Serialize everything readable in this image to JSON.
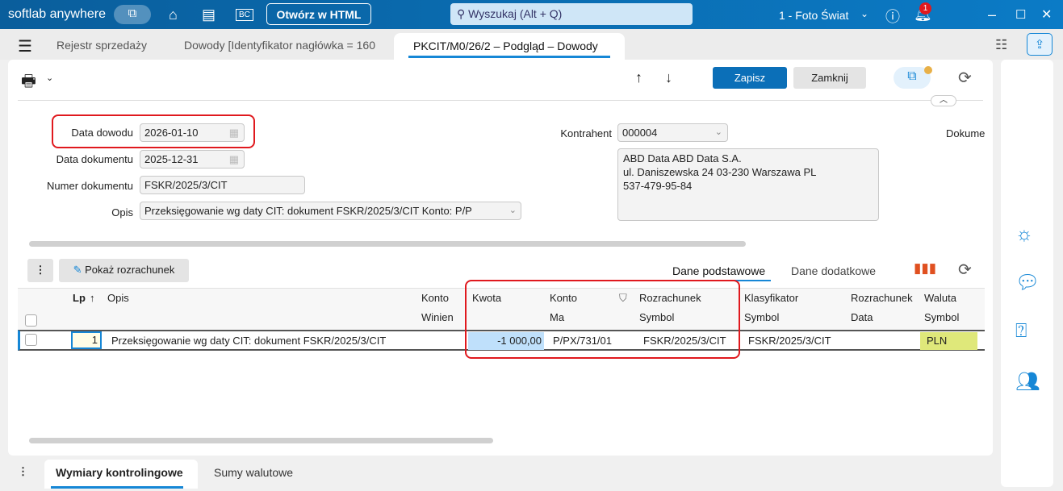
{
  "app": {
    "title": "softlab anywhere",
    "open_html": "Otwórz w HTML",
    "search_placeholder": "Wyszukaj (Alt + Q)",
    "company": "1 - Foto Świat",
    "notifications": "1"
  },
  "tabs": [
    {
      "label": "Rejestr sprzedaży"
    },
    {
      "label": "Dowody [Identyfikator nagłówka = 160"
    },
    {
      "label": "PKCIT/M0/26/2 – Podgląd – Dowody"
    }
  ],
  "toolbar": {
    "save": "Zapisz",
    "close": "Zamknij"
  },
  "form": {
    "data_dowodu_label": "Data dowodu",
    "data_dowodu": "2026-01-10",
    "data_dokumentu_label": "Data dokumentu",
    "data_dokumentu": "2025-12-31",
    "numer_label": "Numer dokumentu",
    "numer": "FSKR/2025/3/CIT",
    "opis_label": "Opis",
    "opis": "Przeksięgowanie wg daty CIT: dokument FSKR/2025/3/CIT Konto: P/P",
    "kontrahent_label": "Kontrahent",
    "kontrahent": "000004",
    "address": [
      "ABD Data ABD Data S.A.",
      "ul. Daniszewska 24 03-230 Warszawa PL",
      "537-479-95-84"
    ],
    "dokument_label": "Dokume"
  },
  "grid": {
    "show_settlement": "Pokaż rozrachunek",
    "tab_basic": "Dane podstawowe",
    "tab_extra": "Dane dodatkowe",
    "headers": [
      [
        "Lp",
        ""
      ],
      [
        "Opis",
        ""
      ],
      [
        "Konto",
        "Winien"
      ],
      [
        "Kwota",
        ""
      ],
      [
        "Konto",
        "Ma"
      ],
      [
        "Rozrachunek",
        "Symbol"
      ],
      [
        "Klasyfikator",
        "Symbol"
      ],
      [
        "Rozrachunek",
        "Data"
      ],
      [
        "Waluta",
        "Symbol"
      ]
    ],
    "rows": [
      {
        "lp": "1",
        "opis": "Przeksięgowanie wg daty CIT: dokument FSKR/2025/3/CIT",
        "konto_winien": "",
        "kwota": "-1 000,00",
        "konto_ma": "P/PX/731/01",
        "rozr_symbol": "FSKR/2025/3/CIT",
        "klasyfikator": "FSKR/2025/3/CIT",
        "rozr_data": "",
        "waluta": "PLN"
      }
    ]
  },
  "bottom_tabs": [
    {
      "label": "Wymiary kontrolingowe"
    },
    {
      "label": "Sumy walutowe"
    }
  ],
  "colors": {
    "accent": "#0b6fb8",
    "highlight": "#e0191e",
    "currency_bg": "#dfe87a",
    "amount_bg": "#bfe0fb"
  }
}
